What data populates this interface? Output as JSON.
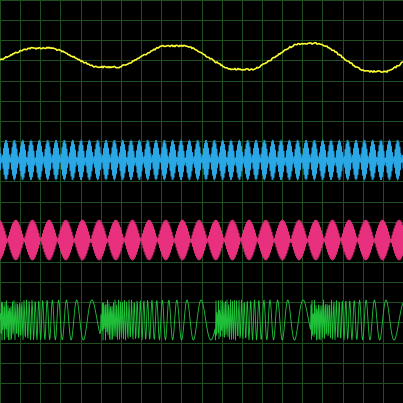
{
  "screen": {
    "background": "#000000",
    "grid_color": "#1f4f1f",
    "grid_divisions": 20
  },
  "traces": [
    {
      "id": "trace-1",
      "color": "#ffff33",
      "kind": "slow-wave",
      "cycles_across_screen": 3
    },
    {
      "id": "trace-2",
      "color": "#2aa8e6",
      "kind": "dense-carrier"
    },
    {
      "id": "trace-3",
      "color": "#e8307f",
      "kind": "dense-carrier"
    },
    {
      "id": "trace-4",
      "color": "#1fbf3a",
      "kind": "frequency-sweep"
    }
  ]
}
